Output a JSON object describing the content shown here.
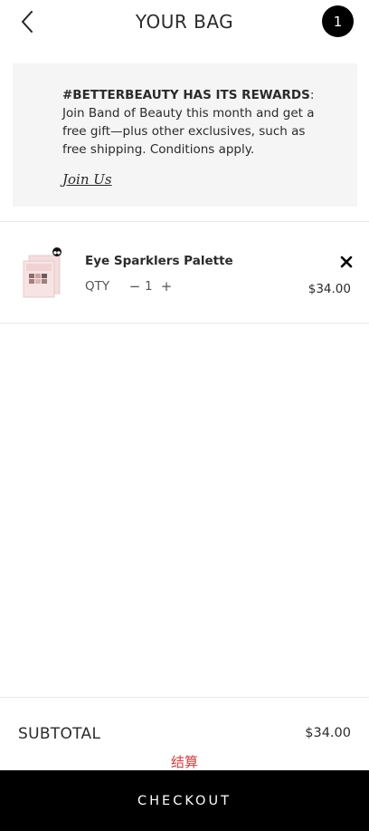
{
  "header": {
    "title": "YOUR BAG",
    "bag_count": "1"
  },
  "rewards": {
    "heading": "#BETTERBEAUTY HAS ITS REWARDS",
    "body": ": Join Band of Beauty this month and get a free gift—plus other exclusives, such as free shipping. Conditions apply.",
    "link_label": "Join Us"
  },
  "cart": {
    "items": [
      {
        "name": "Eye Sparklers Palette",
        "qty_label": "QTY",
        "qty": "1",
        "price": "$34.00"
      }
    ]
  },
  "summary": {
    "subtotal_label": "SUBTOTAL",
    "subtotal_value": "$34.00"
  },
  "annotation": "结算",
  "checkout_label": "CHECKOUT",
  "colors": {
    "banner_bg": "#f5f5f5",
    "text": "#2b2b2b",
    "checkout_bg": "#000000",
    "annotation": "#e03a3a"
  },
  "icons": {
    "back": "chevron-left-icon",
    "remove": "close-icon",
    "minus": "minus-icon",
    "plus": "plus-icon"
  }
}
